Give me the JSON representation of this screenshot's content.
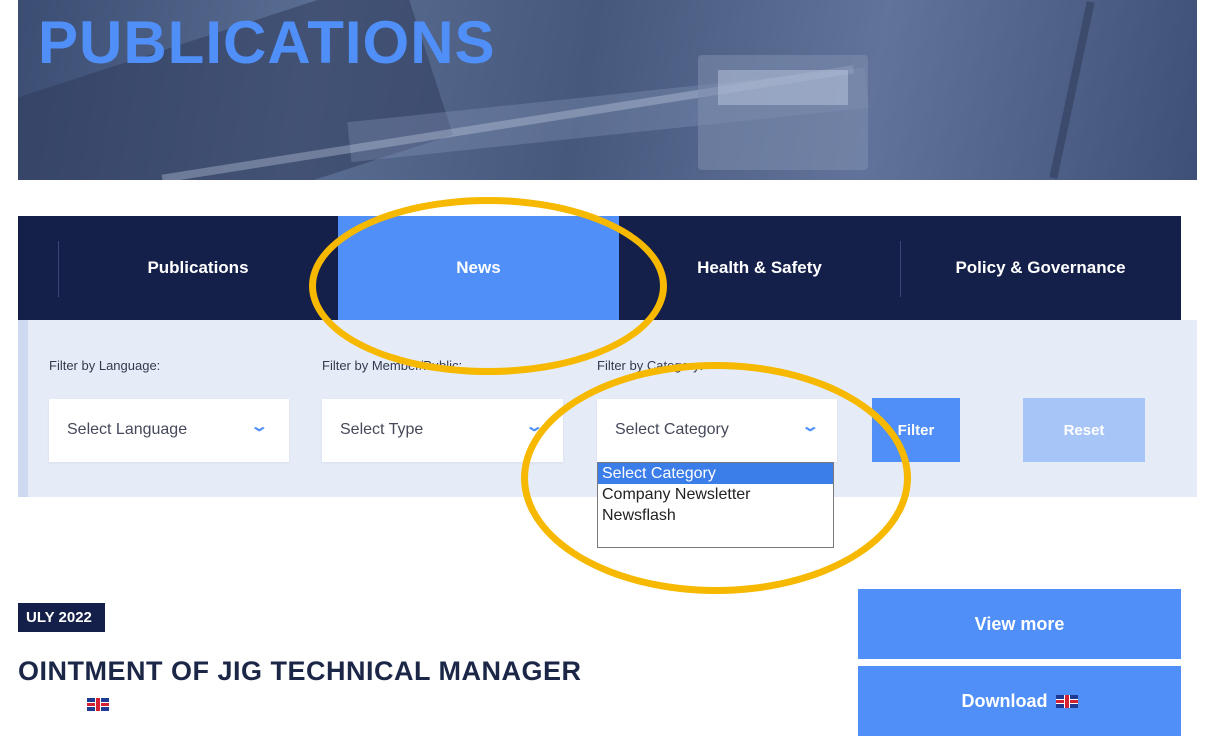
{
  "hero": {
    "title": "PUBLICATIONS"
  },
  "tabs": [
    {
      "label": "Publications"
    },
    {
      "label": "News",
      "active": true
    },
    {
      "label": "Health & Safety"
    },
    {
      "label": "Policy & Governance"
    }
  ],
  "filters": {
    "language": {
      "label": "Filter by Language:",
      "value": "Select Language"
    },
    "type": {
      "label": "Filter by Member/Public:",
      "value": "Select Type"
    },
    "category": {
      "label": "Filter by Category:",
      "value": "Select Category",
      "options": [
        "Select Category",
        "Company Newsletter",
        "Newsflash"
      ],
      "selected_index": 0
    },
    "filter_button": "Filter",
    "reset_button": "Reset"
  },
  "article": {
    "date": "ULY 2022",
    "title": "OINTMENT OF JIG TECHNICAL MANAGER",
    "flag_icon": "uk-flag-icon"
  },
  "actions": {
    "view_more": "View more",
    "download": "Download"
  },
  "colors": {
    "navy": "#15204a",
    "accent_blue": "#4f8ff7",
    "annotation": "#f7b800",
    "filter_bg": "#e5ecf8"
  }
}
